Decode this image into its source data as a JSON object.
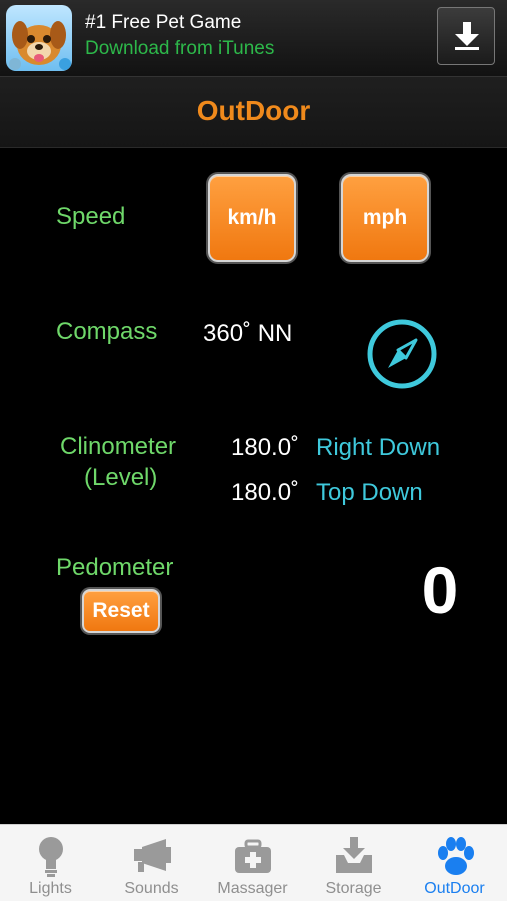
{
  "ad": {
    "title": "#1 Free Pet Game",
    "subtitle": "Download from iTunes",
    "thumbnail_icon": "dog-app-icon",
    "download_icon": "download-arrow-icon"
  },
  "header": {
    "title": "OutDoor"
  },
  "speed": {
    "label": "Speed",
    "kmh_label": "km/h",
    "mph_label": "mph"
  },
  "compass": {
    "label": "Compass",
    "reading": "360˚ NN",
    "icon": "compass-icon"
  },
  "clinometer": {
    "label_line1": "Clinometer",
    "label_line2": "(Level)",
    "right_value": "180.0˚",
    "right_label": "Right Down",
    "top_value": "180.0˚",
    "top_label": "Top Down"
  },
  "pedometer": {
    "label": "Pedometer",
    "reset_label": "Reset",
    "count": "0"
  },
  "tabs": [
    {
      "label": "Lights",
      "icon": "lightbulb-icon",
      "active": false
    },
    {
      "label": "Sounds",
      "icon": "megaphone-icon",
      "active": false
    },
    {
      "label": "Massager",
      "icon": "first-aid-kit-icon",
      "active": false
    },
    {
      "label": "Storage",
      "icon": "storage-tray-icon",
      "active": false
    },
    {
      "label": "OutDoor",
      "icon": "paw-icon",
      "active": true
    }
  ],
  "colors": {
    "accent_orange": "#f08a1c",
    "label_green": "#6fd86a",
    "value_cyan": "#3fc9dc",
    "active_tab_blue": "#1a7ff0"
  }
}
